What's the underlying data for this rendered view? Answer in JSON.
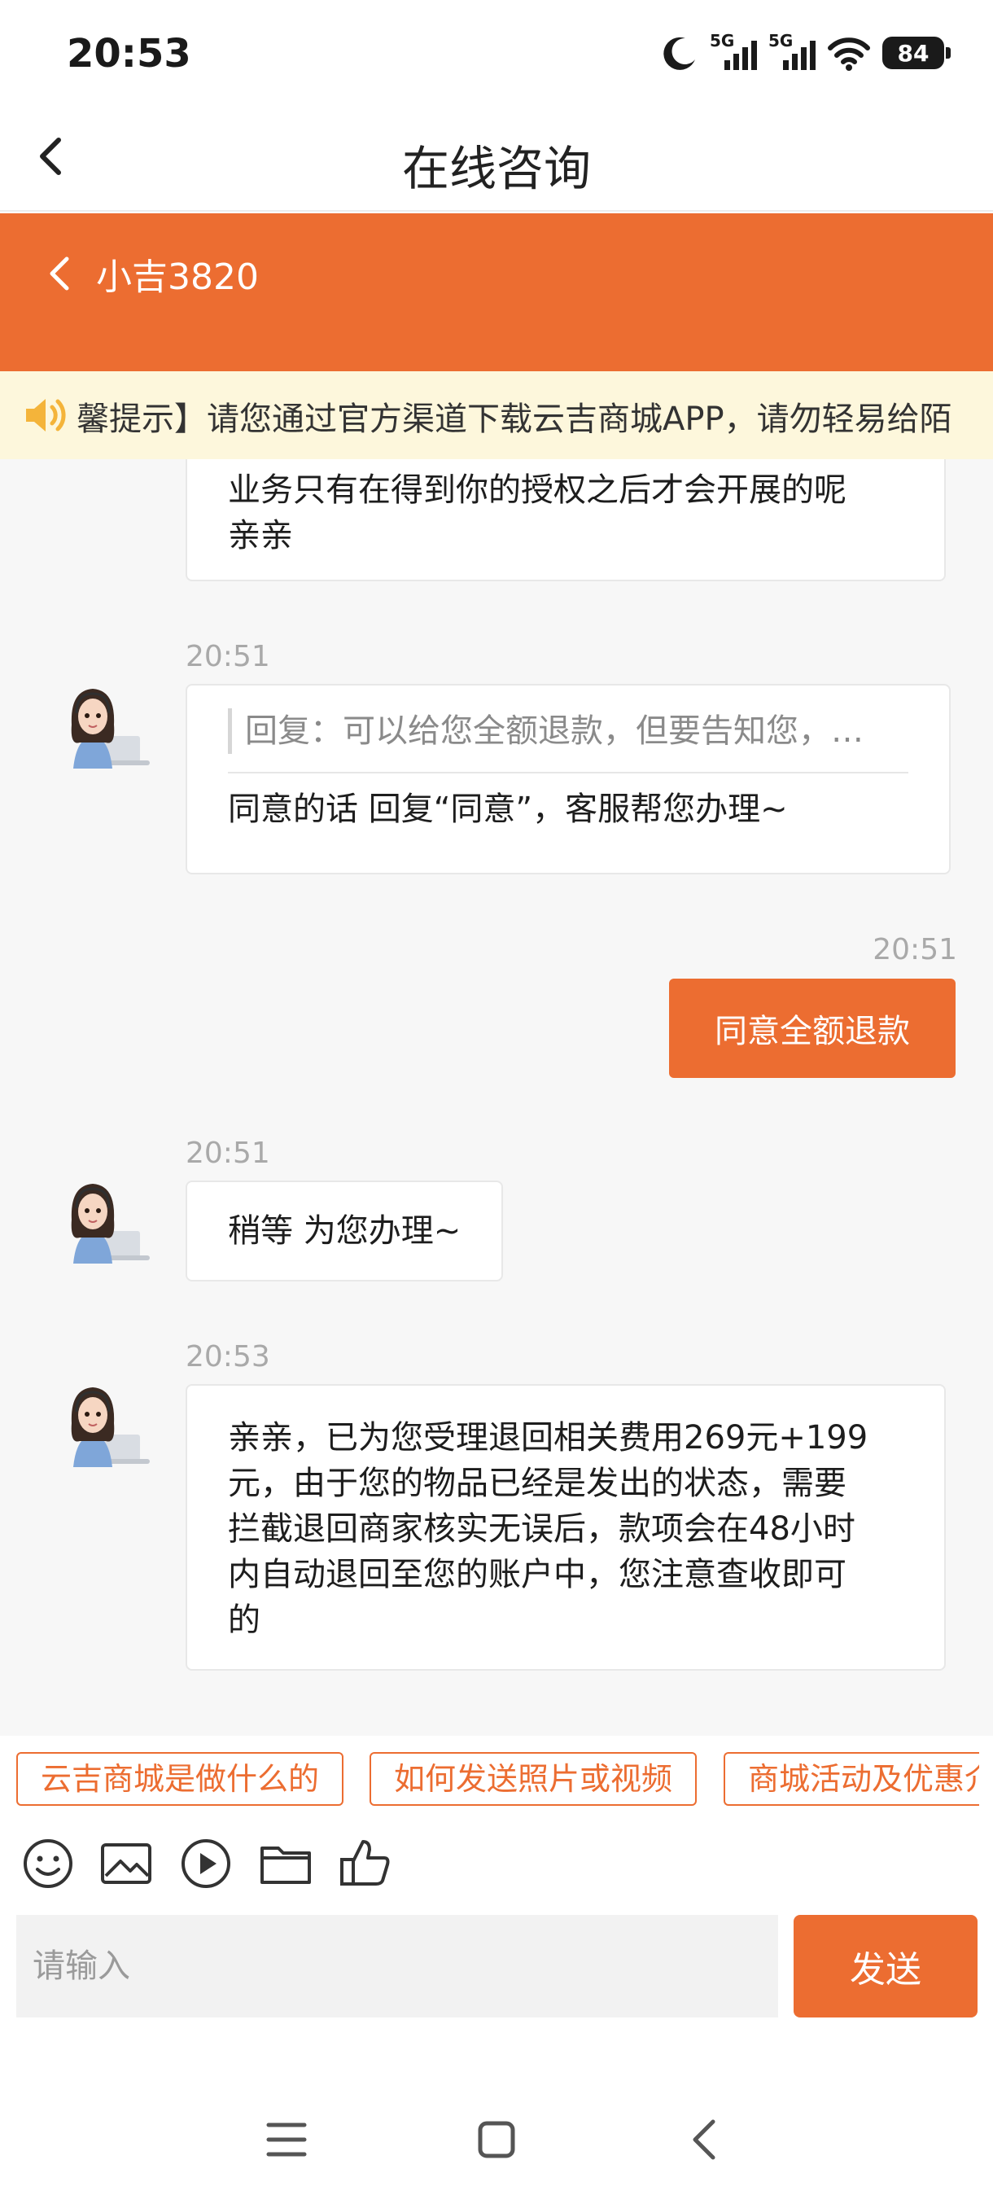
{
  "status_bar": {
    "time": "20:53",
    "network_1": "5G",
    "network_2": "5G",
    "battery": "84"
  },
  "title_bar": {
    "title": "在线咨询"
  },
  "chat_header": {
    "agent_name": "小吉3820"
  },
  "notice": {
    "text": "馨提示】请您通过官方渠道下载云吉商城APP，请勿轻易给陌"
  },
  "messages": [
    {
      "from": "agent",
      "time": "",
      "lines": [
        "业务只有在得到你的授权之后才会开展的呢",
        "亲亲"
      ]
    },
    {
      "from": "agent",
      "time": "20:51",
      "quote": "回复：可以给您全额退款，但要告知您，…",
      "lines": [
        "同意的话 回复“同意”，客服帮您办理~"
      ]
    },
    {
      "from": "user",
      "time": "20:51",
      "lines": [
        "同意全额退款"
      ]
    },
    {
      "from": "agent",
      "time": "20:51",
      "lines": [
        "稍等 为您办理~"
      ]
    },
    {
      "from": "agent",
      "time": "20:53",
      "lines": [
        "亲亲，已为您受理退回相关费用269元+199",
        "元，由于您的物品已经是发出的状态，需要",
        "拦截退回商家核实无误后，款项会在48小时",
        "内自动退回至您的账户中，您注意查收即可",
        "的"
      ]
    }
  ],
  "quick_replies": [
    "云吉商城是做什么的",
    "如何发送照片或视频",
    "商城活动及优惠介"
  ],
  "toolbar": {
    "icons": [
      "smile-icon",
      "image-icon",
      "video-icon",
      "folder-icon",
      "thumbs-up-icon"
    ]
  },
  "input": {
    "placeholder": "请输入",
    "value": "",
    "send_label": "发送"
  },
  "colors": {
    "accent": "#ec6d31",
    "notice_bg": "#fdf7dc",
    "chat_bg": "#f7f7f7"
  }
}
